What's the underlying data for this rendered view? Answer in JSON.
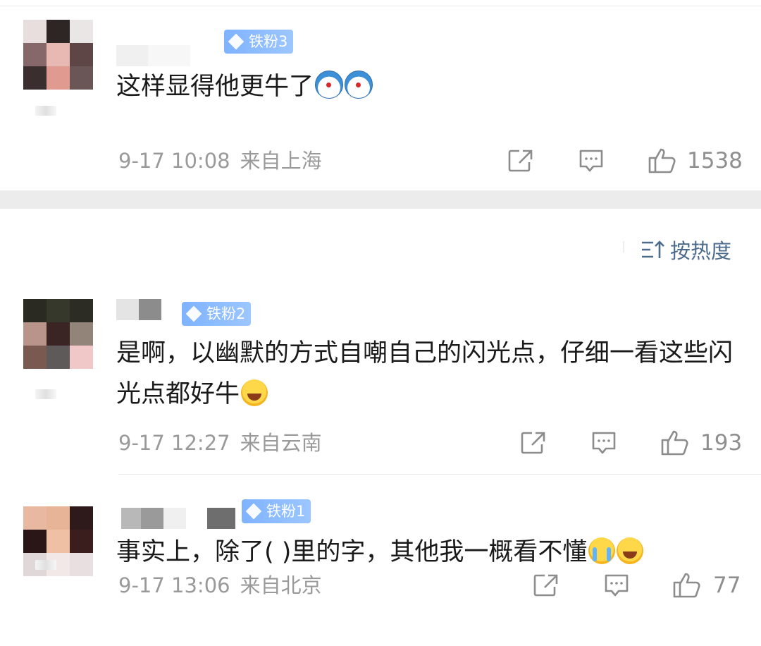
{
  "sort": {
    "label": "按热度"
  },
  "comments": [
    {
      "badge": "铁粉3",
      "text": "这样显得他更牛了",
      "emojis": [
        "doraemon",
        "doraemon"
      ],
      "time": "9-17 10:08",
      "location": "来自上海",
      "likes": "1538"
    },
    {
      "badge": "铁粉2",
      "text": "是啊，以幽默的方式自嘲自己的闪光点，仔细一看这些闪光点都好牛",
      "emojis": [
        "laugh-tears"
      ],
      "time": "9-17 12:27",
      "location": "来自云南",
      "likes": "193"
    },
    {
      "badge": "铁粉1",
      "text": "事实上，除了(  )里的字，其他我一概看不懂",
      "emojis": [
        "crying",
        "laugh-tears"
      ],
      "time": "9-17 13:06",
      "location": "来自北京",
      "likes": "77"
    }
  ],
  "colors": {
    "badge": "#8dbdff",
    "meta": "#9a9a9a",
    "sort": "#4d6c8c"
  },
  "icons": [
    "share-icon",
    "reply-icon",
    "like-icon",
    "sort-icon",
    "diamond-icon"
  ]
}
